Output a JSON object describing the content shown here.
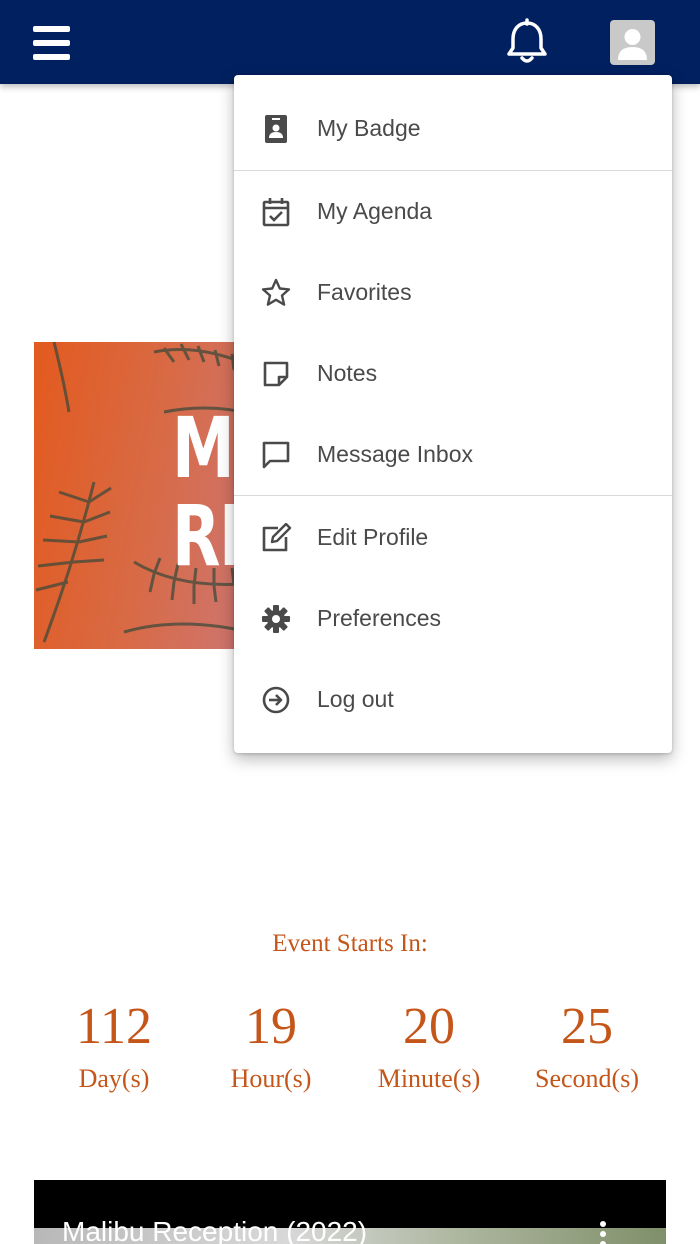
{
  "menu": {
    "items": [
      {
        "label": "My Badge",
        "icon": "badge-icon"
      },
      {
        "label": "My Agenda",
        "icon": "calendar-check-icon"
      },
      {
        "label": "Favorites",
        "icon": "star-icon"
      },
      {
        "label": "Notes",
        "icon": "note-icon"
      },
      {
        "label": "Message Inbox",
        "icon": "message-icon"
      },
      {
        "label": "Edit Profile",
        "icon": "edit-icon"
      },
      {
        "label": "Preferences",
        "icon": "gear-icon"
      },
      {
        "label": "Log out",
        "icon": "logout-icon"
      }
    ]
  },
  "hero": {
    "text_line1": "M",
    "text_line2": "RE"
  },
  "countdown": {
    "title": "Event Starts In:",
    "units": [
      {
        "value": "112",
        "label": "Day(s)"
      },
      {
        "value": "19",
        "label": "Hour(s)"
      },
      {
        "value": "20",
        "label": "Minute(s)"
      },
      {
        "value": "25",
        "label": "Second(s)"
      }
    ]
  },
  "video": {
    "title": "Malibu Reception (2022)"
  },
  "colors": {
    "header_bg": "#00205f",
    "accent": "#c5561a",
    "menu_text": "#4a4a4a",
    "menu_icon": "#4a4a4a"
  }
}
